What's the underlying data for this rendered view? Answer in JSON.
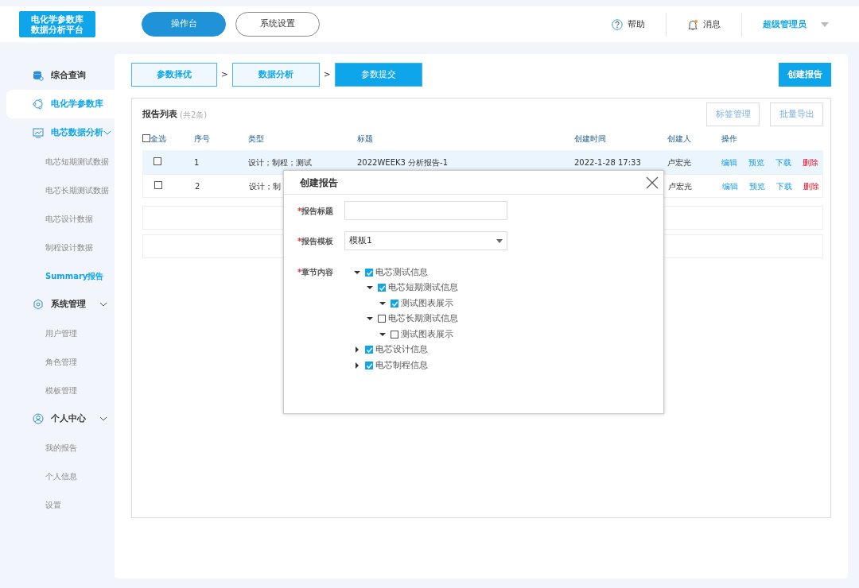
{
  "header": {
    "logo": [
      "电化学参数库",
      "数据分析平台"
    ],
    "nav": [
      {
        "label": "操作台",
        "selected": true
      },
      {
        "label": "系统设置",
        "selected": false
      }
    ],
    "help": "帮助",
    "messages": {
      "label": "消息",
      "unread": true
    },
    "user": "超级管理员"
  },
  "sidebar": {
    "items": [
      {
        "label": "综合查询",
        "selected": false
      },
      {
        "label": "电化学参数库",
        "selected": true
      },
      {
        "label": "电芯数据分析",
        "selected": false,
        "expanded": true,
        "children": [
          {
            "label": "电芯短期测试数据",
            "selected": false
          },
          {
            "label": "电芯长期测试数据",
            "selected": false
          },
          {
            "label": "电芯设计数据",
            "selected": false
          },
          {
            "label": "制程设计数据",
            "selected": false
          },
          {
            "label": "Summary报告",
            "selected": true
          }
        ]
      },
      {
        "label": "系统管理",
        "selected": false,
        "expanded": true,
        "children": [
          {
            "label": "用户管理",
            "selected": false
          },
          {
            "label": "角色管理",
            "selected": false
          },
          {
            "label": "模板管理",
            "selected": false
          }
        ]
      },
      {
        "label": "个人中心",
        "selected": false,
        "expanded": true,
        "children": [
          {
            "label": "我的报告",
            "selected": false
          },
          {
            "label": "个人信息",
            "selected": false
          },
          {
            "label": "设置",
            "selected": false
          }
        ]
      }
    ]
  },
  "steps": [
    {
      "label": "参数择优",
      "selected": false
    },
    {
      "label": "数据分析",
      "selected": false
    },
    {
      "label": "参数提交",
      "selected": true
    }
  ],
  "step_separator": ">",
  "create_button": "创建报告",
  "report_list": {
    "title": "报告列表",
    "count": "(共2条)",
    "buttons": [
      "标签管理",
      "批量导出"
    ],
    "select_all": {
      "label": "全选",
      "checked": false
    },
    "columns": [
      "序号",
      "类型",
      "标题",
      "创建时间",
      "创建人",
      "操作"
    ],
    "rows": [
      {
        "checked": false,
        "highlighted": true,
        "cells": [
          "1",
          "设计；制程；测试",
          "2022WEEK3  分析报告-1",
          "2022-1-28 17:33",
          "卢宏光"
        ],
        "actions": [
          {
            "label": "编辑",
            "kind": "link"
          },
          {
            "label": "预览",
            "kind": "link"
          },
          {
            "label": "下载",
            "kind": "link"
          },
          {
            "label": "删除",
            "kind": "danger"
          }
        ]
      },
      {
        "checked": false,
        "highlighted": false,
        "cells": [
          "2",
          "设计；制",
          "",
          "",
          "卢宏光"
        ],
        "actions": [
          {
            "label": "编辑",
            "kind": "link"
          },
          {
            "label": "预览",
            "kind": "link"
          },
          {
            "label": "下载",
            "kind": "link"
          },
          {
            "label": "删除",
            "kind": "danger"
          }
        ]
      }
    ]
  },
  "dialog": {
    "title": "创建报告",
    "fields": [
      {
        "label": "报告标题",
        "marker": "*",
        "kind": "text"
      },
      {
        "label": "报告模板",
        "marker": "*",
        "kind": "select",
        "value": "模板1"
      },
      {
        "label": "章节内容",
        "marker": "*",
        "kind": "tree"
      }
    ],
    "tree": [
      {
        "label": "电芯测试信息",
        "checked": true,
        "expanded": true,
        "children": [
          {
            "label": "电芯短期测试信息",
            "checked": true,
            "expanded": true,
            "children": [
              {
                "label": "测试图表展示",
                "checked": true,
                "expanded": true
              }
            ]
          },
          {
            "label": "电芯长期测试信息",
            "checked": false,
            "expanded": true,
            "children": [
              {
                "label": "测试图表展示",
                "checked": false,
                "expanded": true
              }
            ]
          }
        ]
      },
      {
        "label": "电芯设计信息",
        "checked": true,
        "expanded": false
      },
      {
        "label": "电芯制程信息",
        "checked": true,
        "expanded": false
      }
    ]
  }
}
